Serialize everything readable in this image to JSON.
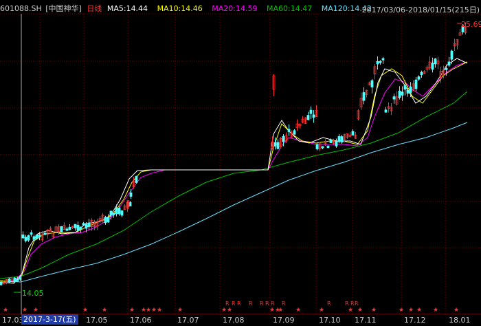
{
  "header": {
    "symbol": "601088.SH",
    "name": "[中国神华]",
    "period": "日线",
    "ma5": "MA5:14.44",
    "ma10": "MA10:14.46",
    "ma20": "MA20:14.59",
    "ma60": "MA60:14.47",
    "ma120": "MA120:14.42",
    "range": "2017/03/06-2018/01/15(215日)"
  },
  "colors": {
    "background": "#000000",
    "up": "#ff3030",
    "down": "#54ffff",
    "ma5": "#ffffff",
    "ma10": "#ffff00",
    "ma20": "#ff00ff",
    "ma60": "#00c000",
    "ma120": "#66e0ff",
    "grid": "#7a0000",
    "marker": "#ff3030"
  },
  "annotations": {
    "high_label": "25.69",
    "low_label": "14.05"
  },
  "x_axis": {
    "ticks": [
      "17.03",
      "17.05",
      "17.06",
      "17.07",
      "17.08",
      "17.09",
      "17.10",
      "17.11",
      "17.12",
      "18.01"
    ],
    "cursor_label": "2017-3-17(五)"
  },
  "chart_data": {
    "type": "candlestick",
    "x_start": "2017-03-06",
    "x_end": "2018-01-15",
    "trading_days": 215,
    "y_high": 25.69,
    "y_low": 14.05,
    "moving_averages": [
      "MA5",
      "MA10",
      "MA20",
      "MA60",
      "MA120"
    ],
    "last_values": {
      "MA5": 14.44,
      "MA10": 14.46,
      "MA20": 14.59,
      "MA60": 14.47,
      "MA120": 14.42
    }
  }
}
